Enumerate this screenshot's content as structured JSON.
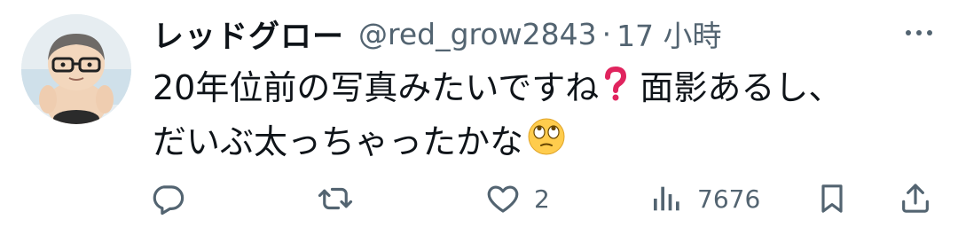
{
  "tweet": {
    "display_name": "レッドグロー",
    "handle": "@red_grow2843",
    "separator": "·",
    "time": "17 小時",
    "text_line1": "20年位前の写真みたいですね",
    "text_line1_tail": "面影あるし、",
    "text_line2": "だいぶ太っちゃったかな"
  },
  "actions": {
    "reply_count": "",
    "retweet_count": "",
    "like_count": "2",
    "views_count": "7676"
  },
  "icons": {
    "question_mark": "red-question-mark-icon",
    "emoji": "face-with-rolling-eyes-icon",
    "more": "more-dots-icon",
    "reply": "reply-icon",
    "retweet": "retweet-icon",
    "like": "heart-icon",
    "views": "views-chart-icon",
    "bookmark": "bookmark-icon",
    "share": "share-icon"
  },
  "colors": {
    "text": "#0f1419",
    "secondary": "#536471",
    "question_mark": "#e0245e",
    "emoji_yellow": "#ffcc4d"
  }
}
